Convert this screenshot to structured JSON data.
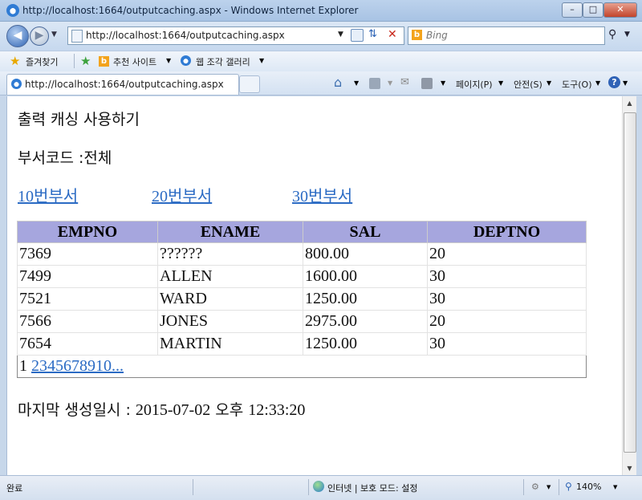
{
  "window": {
    "title": "http://localhost:1664/outputcaching.aspx - Windows Internet Explorer"
  },
  "address": {
    "url": "http://localhost:1664/outputcaching.aspx",
    "search_placeholder": "Bing"
  },
  "favorites_bar": {
    "favorites": "즐겨찾기",
    "suggested_sites": "추천 사이트",
    "web_slice_gallery": "웹 조각 갤러리"
  },
  "tab": {
    "title": "http://localhost:1664/outputcaching.aspx"
  },
  "command_bar": {
    "page": "페이지(P)",
    "safety": "안전(S)",
    "tools": "도구(O)"
  },
  "page": {
    "heading": "출력 캐싱 사용하기",
    "dept_label": "부서코드 :",
    "dept_value": "전체",
    "links": [
      "10번부서",
      "20번부서",
      "30번부서"
    ],
    "grid": {
      "columns": [
        "EMPNO",
        "ENAME",
        "SAL",
        "DEPTNO"
      ],
      "rows": [
        [
          "7369",
          "??????",
          "800.00",
          "20"
        ],
        [
          "7499",
          "ALLEN",
          "1600.00",
          "30"
        ],
        [
          "7521",
          "WARD",
          "1250.00",
          "30"
        ],
        [
          "7566",
          "JONES",
          "2975.00",
          "20"
        ],
        [
          "7654",
          "MARTIN",
          "1250.00",
          "30"
        ]
      ],
      "pager": {
        "current": "1",
        "pages": [
          "2",
          "3",
          "4",
          "5",
          "6",
          "7",
          "8",
          "9",
          "10"
        ],
        "more": "..."
      }
    },
    "generated_label": "마지막 생성일시 : ",
    "generated_date": "2015-07-02",
    "generated_ampm": "오후",
    "generated_time": "12:33:20"
  },
  "status": {
    "left": "완료",
    "zone": "인터넷 | 보호 모드: 설정",
    "zoom": "140%"
  },
  "colors": {
    "link": "#2b6bc4",
    "grid_header": "#a6a6de"
  }
}
